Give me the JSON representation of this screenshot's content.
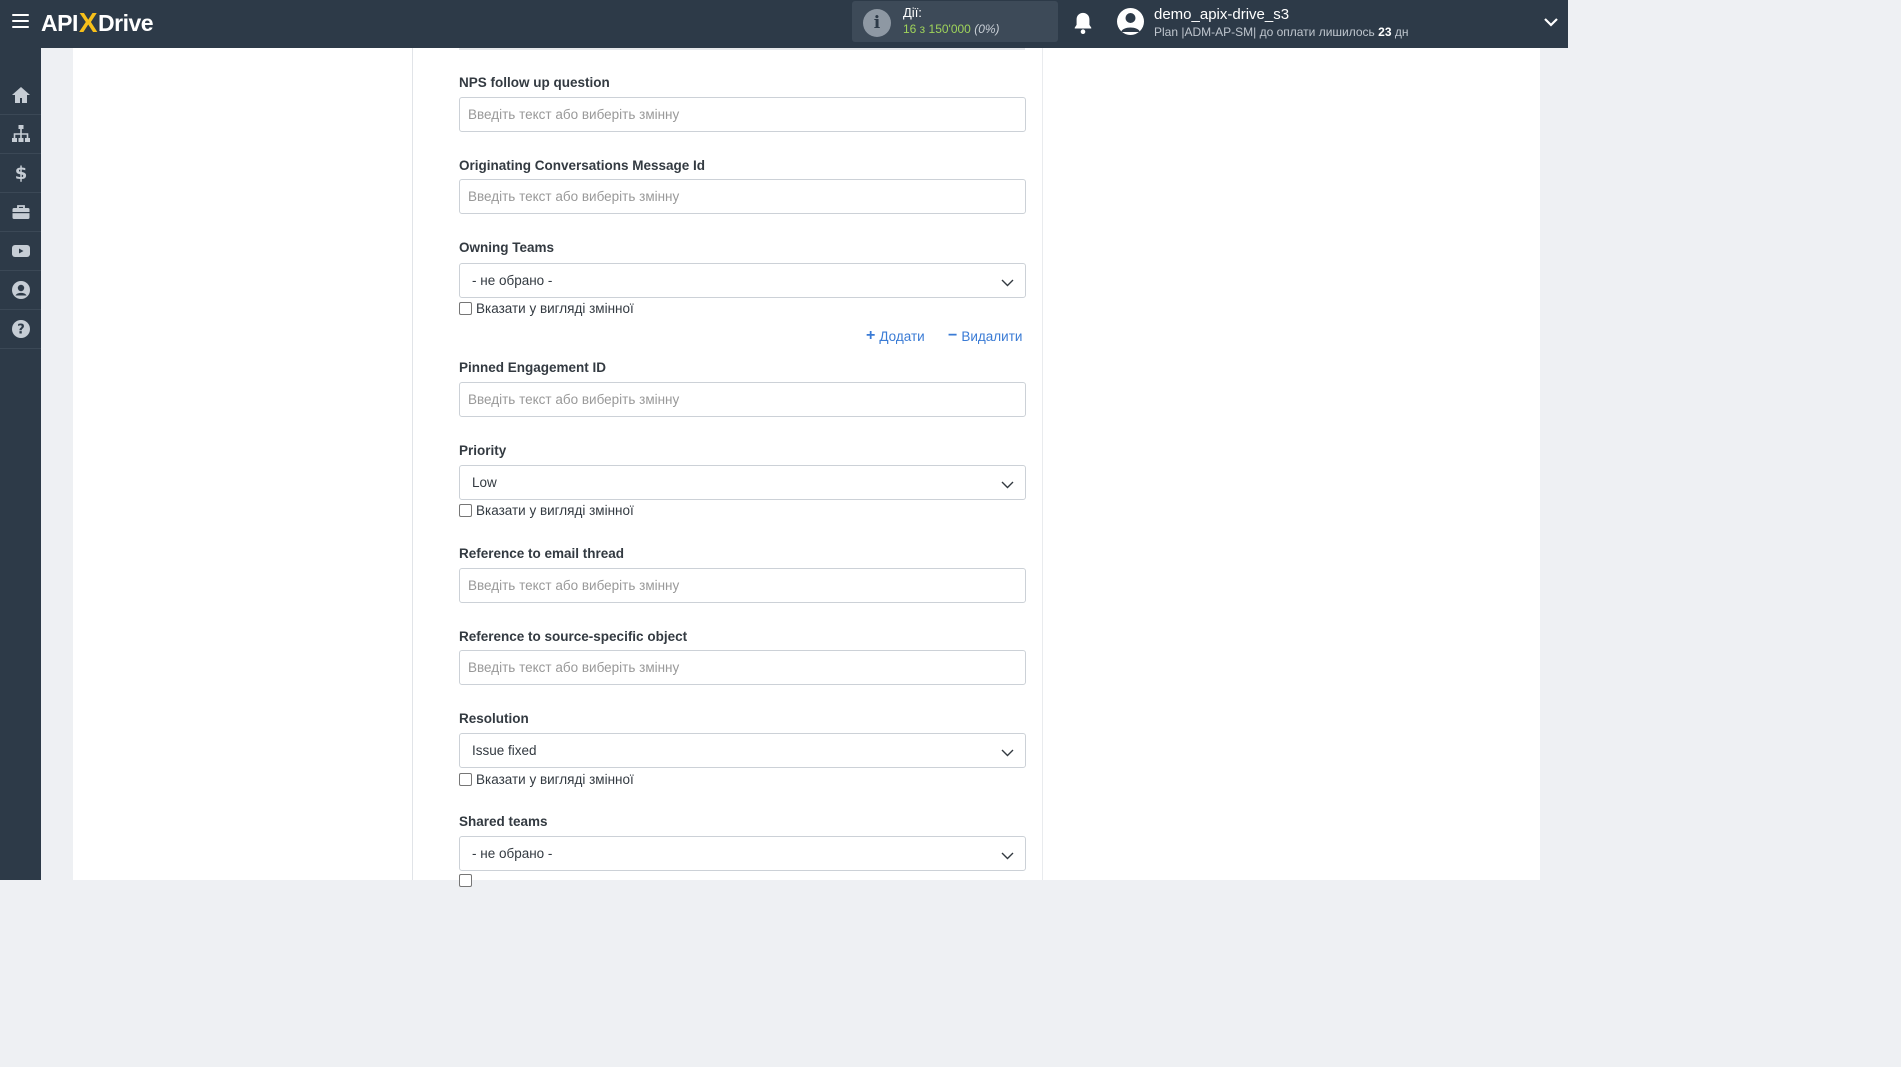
{
  "header": {
    "logo_left": "API",
    "logo_x": "X",
    "logo_right": "Drive",
    "actions_label": "Дії:",
    "actions_count": "16 з 150'000",
    "actions_pct": "(0%)",
    "user_name": "demo_apix-drive_s3",
    "plan_prefix": "Plan |ADM-AP-SM| до оплати лишилось ",
    "plan_days": "23",
    "plan_suffix": " дн"
  },
  "sidebar": {
    "items": [
      "home-icon",
      "sitemap-icon",
      "dollar-icon",
      "briefcase-icon",
      "youtube-icon",
      "user-circle-icon",
      "help-icon"
    ]
  },
  "form": {
    "placeholder": "Введіть текст або виберіть змінну",
    "variable_checkbox_label": "Вказати у вигляді змінної",
    "add_label": "Додати",
    "remove_label": "Видалити",
    "fields": {
      "nps_followup": "NPS follow up question",
      "orig_msg_id": "Originating Conversations Message Id",
      "owning_teams": "Owning Teams",
      "owning_teams_value": "- не обрано -",
      "pinned_id": "Pinned Engagement ID",
      "priority": "Priority",
      "priority_value": "Low",
      "ref_email": "Reference to email thread",
      "ref_source": "Reference to source-specific object",
      "resolution": "Resolution",
      "resolution_value": "Issue fixed",
      "shared_teams": "Shared teams",
      "shared_teams_value": "- не обрано -"
    }
  },
  "colors": {
    "topbar": "#2d3a48",
    "accent_link": "#3a7bd5",
    "logo_x": "#f7c01a",
    "actions_green": "#9fd35a"
  }
}
